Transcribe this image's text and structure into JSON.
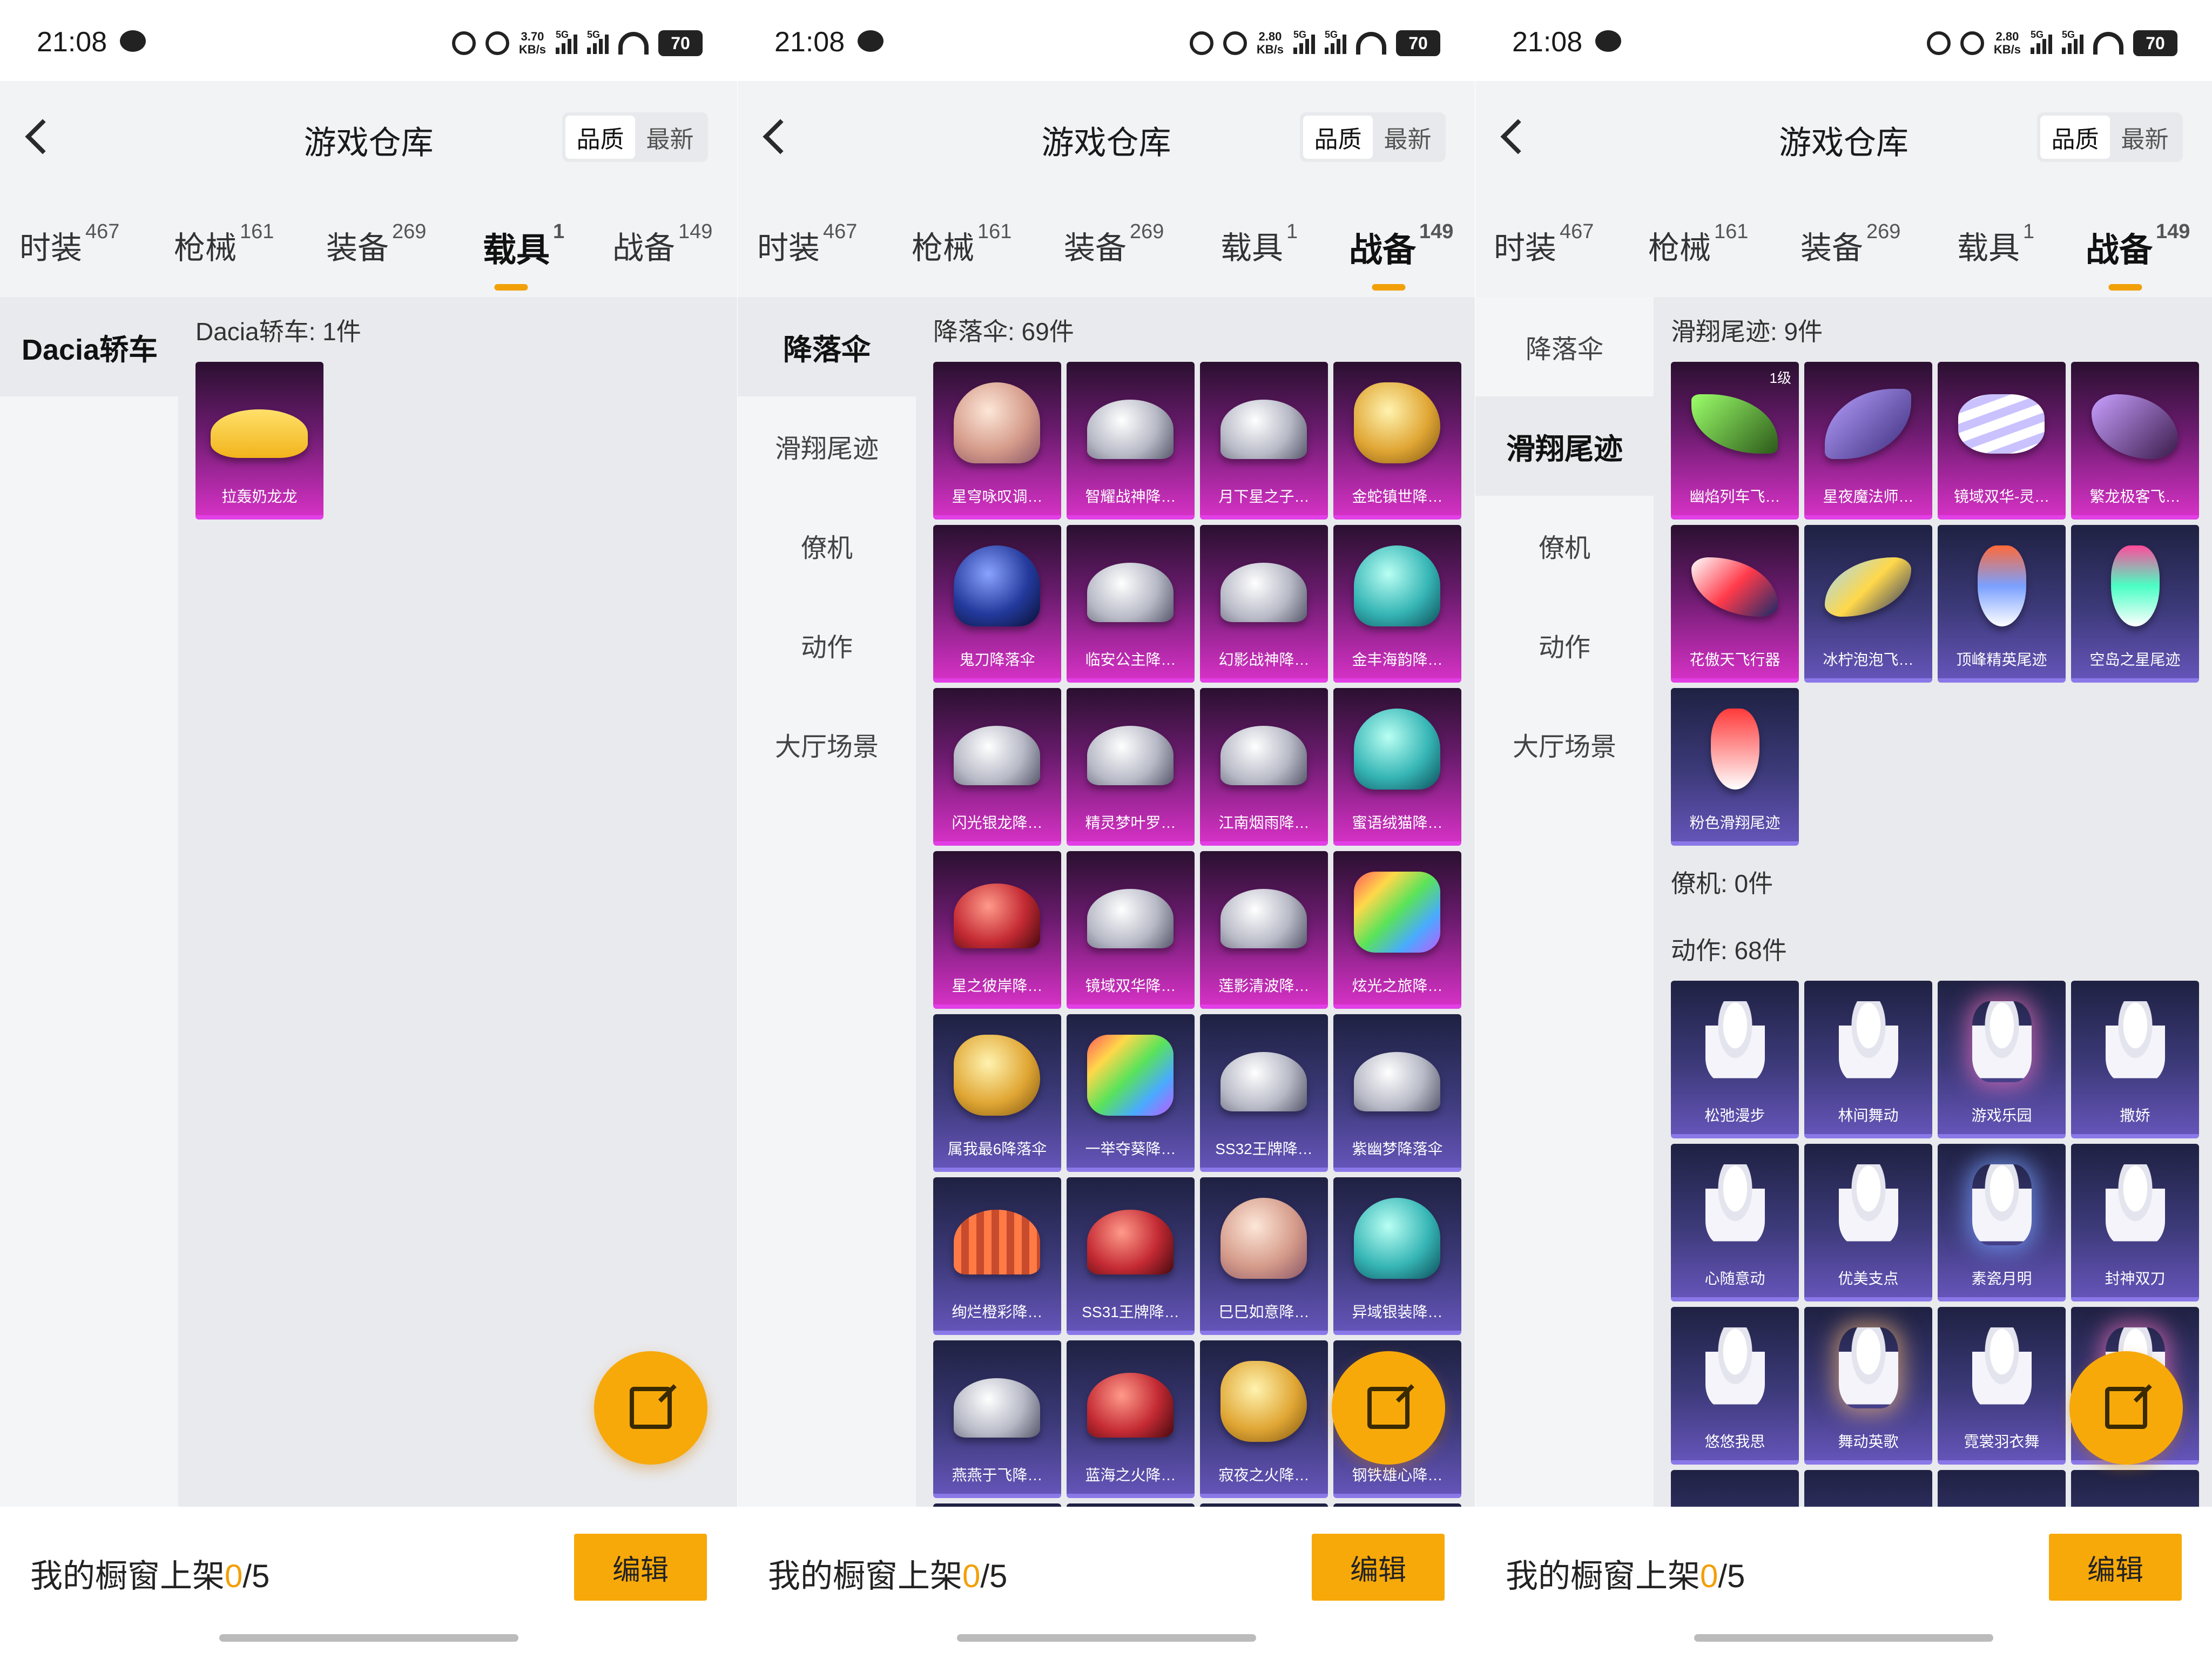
{
  "status": {
    "time": "21:08",
    "speeds": [
      "3.70",
      "2.80",
      "2.80"
    ],
    "speed_unit": "KB/s",
    "signal_label": "5G",
    "battery": "70"
  },
  "header": {
    "title": "游戏仓库",
    "sort_quality": "品质",
    "sort_latest": "最新"
  },
  "categories": [
    {
      "label": "时装",
      "count": "467"
    },
    {
      "label": "枪械",
      "count": "161"
    },
    {
      "label": "装备",
      "count": "269"
    },
    {
      "label": "载具",
      "count": "1"
    },
    {
      "label": "战备",
      "count": "149"
    }
  ],
  "screen1": {
    "side": [
      "Dacia轿车"
    ],
    "section": "Dacia轿车: 1件",
    "items": [
      "拉轰奶龙龙"
    ]
  },
  "screen2": {
    "side": [
      "降落伞",
      "滑翔尾迹",
      "僚机",
      "动作",
      "大厅场景"
    ],
    "section": "降落伞: 69件",
    "items": [
      "星穹咏叹调…",
      "智耀战神降…",
      "月下星之子…",
      "金蛇镇世降…",
      "鬼刀降落伞",
      "临安公主降…",
      "幻影战神降…",
      "金丰海韵降…",
      "闪光银龙降…",
      "精灵梦叶罗…",
      "江南烟雨降…",
      "蜜语绒猫降…",
      "星之彼岸降…",
      "镜域双华降…",
      "莲影清波降…",
      "炫光之旅降…",
      "属我最6降落伞",
      "一举夺葵降…",
      "SS32王牌降…",
      "紫幽梦降落伞",
      "绚烂橙彩降…",
      "SS31王牌降…",
      "巳巳如意降…",
      "异域银装降…",
      "燕燕于飞降…",
      "蓝海之火降…",
      "寂夜之火降…",
      "钢铁雄心降…"
    ]
  },
  "screen3": {
    "side": [
      "降落伞",
      "滑翔尾迹",
      "僚机",
      "动作",
      "大厅场景"
    ],
    "section_trails": "滑翔尾迹: 9件",
    "trails": [
      "幽焰列车飞…",
      "星夜魔法师…",
      "镜域双华-灵…",
      "繁龙极客飞…",
      "花傲天飞行器",
      "冰柠泡泡飞…",
      "顶峰精英尾迹",
      "空岛之星尾迹",
      "粉色滑翔尾迹"
    ],
    "trail_level": "1级",
    "section_wingman": "僚机: 0件",
    "section_actions": "动作: 68件",
    "actions": [
      "松弛漫步",
      "林间舞动",
      "游戏乐园",
      "撒娇",
      "心随意动",
      "优美支点",
      "素瓷月明",
      "封神双刀",
      "悠悠我思",
      "舞动英歌",
      "霓裳羽衣舞",
      ""
    ]
  },
  "bottom": {
    "shelf_label": "我的橱窗上架",
    "shelf_count": "0",
    "shelf_total": "/5",
    "edit": "编辑"
  }
}
